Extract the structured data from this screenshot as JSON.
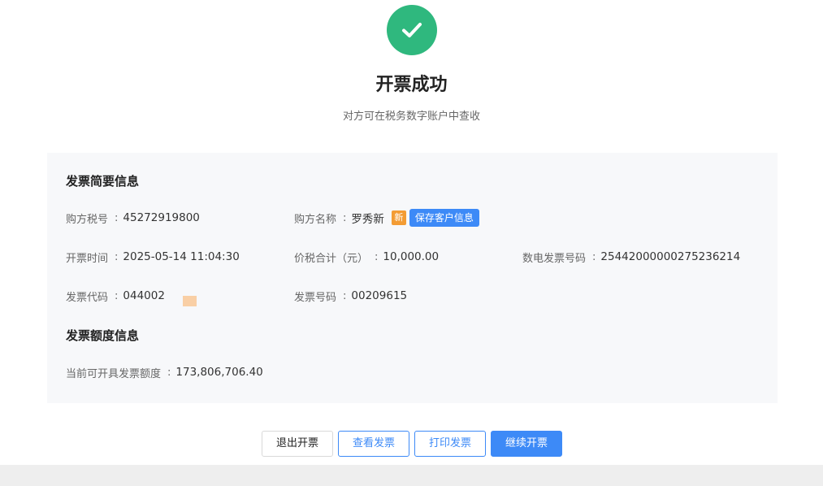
{
  "result": {
    "title": "开票成功",
    "subtitle": "对方可在税务数字账户中查收",
    "icon": "check-circle-icon",
    "icon_color": "#2fb87e"
  },
  "summary": {
    "section_title": "发票简要信息",
    "buyer_tax_no": {
      "label": "购方税号",
      "value": "45272919800"
    },
    "buyer_name": {
      "label": "购方名称",
      "value": "罗秀新",
      "new_tag": "新",
      "save_button": "保存客户信息"
    },
    "issue_time": {
      "label": "开票时间",
      "value": "2025-05-14 11:04:30"
    },
    "total_amount": {
      "label": "价税合计（元）",
      "value": "10,000.00"
    },
    "e_invoice_no": {
      "label": "数电发票号码",
      "value": "25442000000275236214"
    },
    "invoice_code": {
      "label": "发票代码",
      "value": "044002"
    },
    "invoice_no": {
      "label": "发票号码",
      "value": "00209615"
    }
  },
  "quota": {
    "section_title": "发票额度信息",
    "available": {
      "label": "当前可开具发票额度",
      "value": "173,806,706.40"
    }
  },
  "actions": {
    "exit": "退出开票",
    "view": "查看发票",
    "print": "打印发票",
    "continue": "继续开票"
  },
  "colors": {
    "primary": "#3d8af7",
    "success": "#2fb87e",
    "new_tag": "#f39c34"
  }
}
